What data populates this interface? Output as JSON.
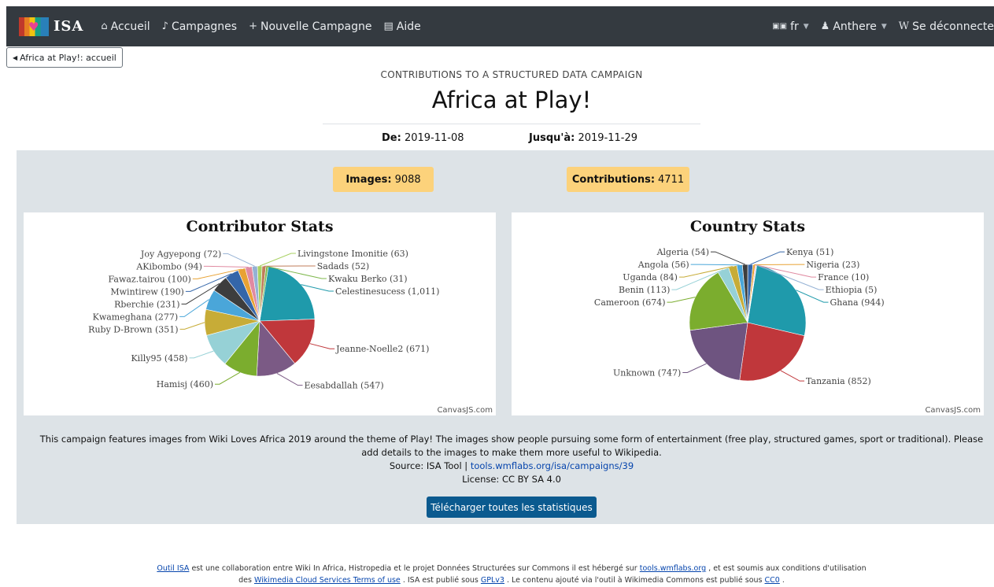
{
  "nav": {
    "brand": "ISA",
    "items": [
      {
        "icon": "home-icon",
        "glyph": "⌂",
        "label": "Accueil"
      },
      {
        "icon": "bell-icon",
        "glyph": "♪",
        "label": "Campagnes"
      },
      {
        "icon": "plus-icon",
        "glyph": "+",
        "label": "Nouvelle Campagne"
      },
      {
        "icon": "book-icon",
        "glyph": "▤",
        "label": "Aide"
      }
    ],
    "lang": "fr",
    "user": "Anthere",
    "logout": "Se déconnecte"
  },
  "back_label": "Africa at Play!: accueil",
  "header": {
    "subtitle": "CONTRIBUTIONS TO A STRUCTURED DATA CAMPAIGN",
    "title": "Africa at Play!",
    "from_label": "De:",
    "from_value": "2019-11-08",
    "to_label": "Jusqu'à:",
    "to_value": "2019-11-29"
  },
  "stats": {
    "images_label": "Images:",
    "images_value": "9088",
    "contrib_label": "Contributions:",
    "contrib_value": "4711"
  },
  "chart_data": [
    {
      "type": "pie",
      "title": "Contributor Stats",
      "credit": "CanvasJS.com",
      "labels": [
        "Celestinesucess",
        "Jeanne-Noelle2",
        "Eesabdallah",
        "Hamisj",
        "Killy95",
        "Ruby D-Brown",
        "Kwameghana",
        "Rberchie",
        "Mwintirew",
        "Fawaz.tairou",
        "AKibombo",
        "Joy Agyepong",
        "Livingstone Imonitie",
        "Sadads",
        "Kwaku Berko"
      ],
      "values": [
        1011,
        671,
        547,
        460,
        458,
        351,
        277,
        231,
        190,
        100,
        94,
        72,
        63,
        52,
        31
      ],
      "display": [
        "Celestinesucess (1,011)",
        "Jeanne-Noelle2 (671)",
        "Eesabdallah (547)",
        "Hamisj (460)",
        "Killy95 (458)",
        "Ruby D-Brown (351)",
        "Kwameghana (277)",
        "Rberchie (231)",
        "Mwintirew (190)",
        "Fawaz.tairou (100)",
        "AKibombo (94)",
        "Joy Agyepong (72)",
        "Livingstone Imonitie (63)",
        "Sadads (52)",
        "Kwaku Berko (31)"
      ],
      "colors": [
        "#1f9aab",
        "#c0373b",
        "#7b5a85",
        "#7bad2e",
        "#96d1d6",
        "#c7ac37",
        "#4aa6d9",
        "#3d3d3d",
        "#3466a9",
        "#e8a234",
        "#e08aa1",
        "#94b1d4",
        "#a9d163",
        "#c07d5a",
        "#7fb84d"
      ]
    },
    {
      "type": "pie",
      "title": "Country Stats",
      "credit": "CanvasJS.com",
      "labels": [
        "Ghana",
        "Tanzania",
        "Unknown",
        "Cameroon",
        "Benin",
        "Uganda",
        "Angola",
        "Algeria",
        "Kenya",
        "Nigeria",
        "France",
        "Ethiopia"
      ],
      "values": [
        944,
        852,
        747,
        674,
        113,
        84,
        56,
        54,
        51,
        23,
        10,
        5
      ],
      "display": [
        "Ghana (944)",
        "Tanzania (852)",
        "Unknown (747)",
        "Cameroon (674)",
        "Benin (113)",
        "Uganda (84)",
        "Angola (56)",
        "Algeria (54)",
        "Kenya (51)",
        "Nigeria (23)",
        "France (10)",
        "Ethiopia (5)"
      ],
      "colors": [
        "#1f9aab",
        "#c0373b",
        "#6e5480",
        "#7bad2e",
        "#96d1d6",
        "#c7ac37",
        "#4aa6d9",
        "#3d3d3d",
        "#3466a9",
        "#e8a234",
        "#e08aa1",
        "#94b1d4"
      ]
    }
  ],
  "description": {
    "text": "This campaign features images from Wiki Loves Africa 2019 around the theme of Play! The images show people pursuing some form of entertainment (free play, structured games, sport or traditional). Please add details to the images to make them more useful to Wikipedia.",
    "source_prefix": "Source: ISA Tool |",
    "source_link": "tools.wmflabs.org/isa/campaigns/39",
    "license": "License: CC BY SA 4.0"
  },
  "download_label": "Télécharger toutes les statistiques",
  "footer": {
    "l1_link1": "Outil ISA",
    "l1_text1": "est une collaboration entre Wiki In Africa, Histropedia et le projet Données Structurées sur Commons il est hébergé sur",
    "l1_link2": "tools.wmflabs.org",
    "l1_text2": ", et est soumis aux conditions d'utilisation",
    "l2_text0": "des",
    "l2_link1": "Wikimedia Cloud Services Terms of use",
    "l2_text1": ". ISA est publié sous",
    "l2_link2": "GPLv3",
    "l2_text2": ". Le contenu ajouté via l'outil à Wikimedia Commons est publié sous",
    "l2_link3": "CC0",
    "l2_text3": "."
  }
}
